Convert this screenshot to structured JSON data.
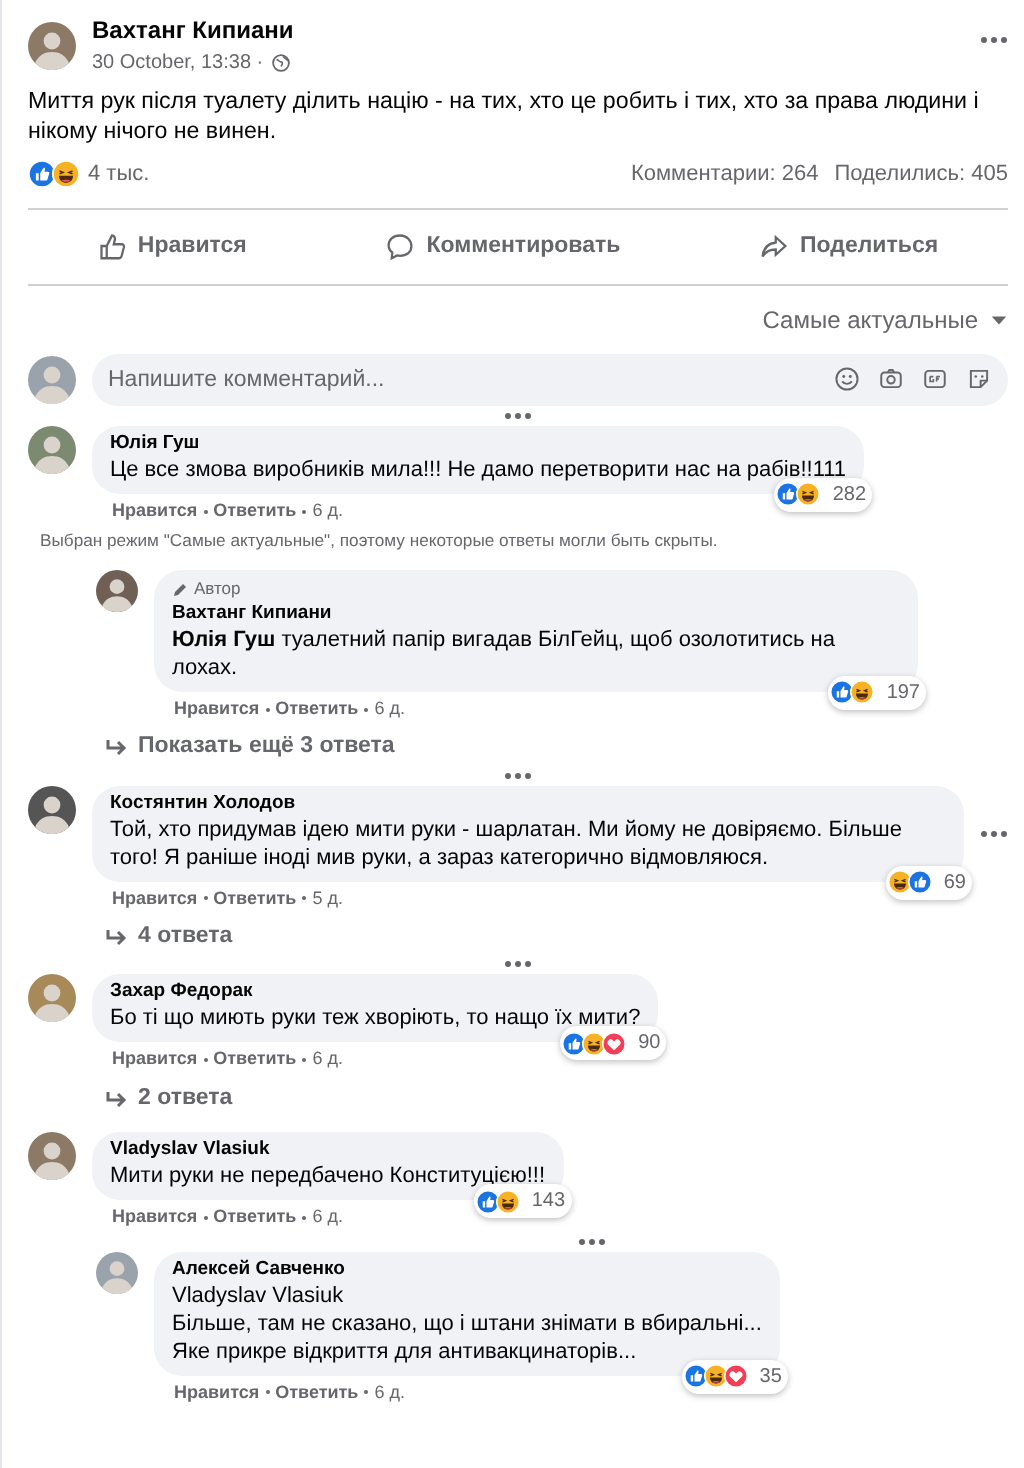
{
  "post": {
    "author": "Вахтанг Кипиани",
    "time": "30 October, 13:38 ·",
    "text": "Миття рук після туалету ділить націю - на тих, хто це робить і тих, хто за права людини і нікому нічого не винен.",
    "reactions": [
      {
        "kind": "like"
      },
      {
        "kind": "haha"
      }
    ],
    "reaction_count": "4 тыс.",
    "comments_count": "Комментарии: 264",
    "shares_count": "Поделились: 405"
  },
  "actions": [
    {
      "kind": "like",
      "label": "Нравится"
    },
    {
      "kind": "comment",
      "label": "Комментировать"
    },
    {
      "kind": "share",
      "label": "Поделиться"
    }
  ],
  "sort": "Самые актуальные",
  "comment_box": {
    "placeholder": "Напишите комментарий..."
  },
  "comments": [
    {
      "menu_above": true,
      "author": "Юлія Гуш",
      "text": "Це все змова виробників мила!!! Не дамо перетворити нас на рабів!!111",
      "reactions": [
        {
          "kind": "like"
        },
        {
          "kind": "haha"
        }
      ],
      "reaction_count": "282",
      "actions": [
        "Нравится",
        "Ответить"
      ],
      "time": "6 д.",
      "note": "Выбран режим \"Самые актуальные\", поэтому некоторые ответы могли быть скрыты.",
      "replies": [
        {
          "badge": "Автор",
          "author": "Вахтанг Кипиани",
          "text": "**Юлія Гуш** туалетний папір вигадав БілГейц, щоб озолотитись на лохах.",
          "reactions": [
            {
              "kind": "like"
            },
            {
              "kind": "haha"
            }
          ],
          "reaction_count": "197",
          "actions": [
            "Нравится",
            "Ответить"
          ],
          "time": "6 д."
        }
      ],
      "more_replies": "Показать ещё 3 ответа"
    },
    {
      "menu_above": true,
      "side_menu": true,
      "author": "Костянтин Холодов",
      "text": "Той, хто придумав ідею мити руки - шарлатан. Ми йому не довіряємо. Більше того! Я раніше іноді мив руки, а зараз категорично відмовляюся.",
      "reactions": [
        {
          "kind": "haha"
        },
        {
          "kind": "like"
        }
      ],
      "reaction_count": "69",
      "actions": [
        "Нравится",
        "Ответить"
      ],
      "time": "5 д.",
      "more_replies": "4 ответа"
    },
    {
      "menu_above": true,
      "author": "Захар Федорак",
      "text": "Бо ті що миють руки теж хворіють, то нащо їх мити?",
      "reactions": [
        {
          "kind": "like"
        },
        {
          "kind": "haha"
        },
        {
          "kind": "love"
        }
      ],
      "reaction_count": "90",
      "actions": [
        "Нравится",
        "Ответить"
      ],
      "time": "6 д.",
      "more_replies": "2 ответа"
    },
    {
      "author": "Vladyslav Vlasiuk",
      "text": "Мити руки не передбачено Конституцією!!!",
      "reactions": [
        {
          "kind": "like"
        },
        {
          "kind": "haha"
        }
      ],
      "reaction_count": "143",
      "actions": [
        "Нравится",
        "Ответить"
      ],
      "time": "6 д.",
      "replies": [
        {
          "menu_above": true,
          "author": "Алексей Савченко",
          "text": "Vladyslav Vlasiuk\nБільше, там не сказано, що і штани знімати в вбиральні...\nЯке прикре відкриття для антивакцинаторів...",
          "reactions": [
            {
              "kind": "like"
            },
            {
              "kind": "haha"
            },
            {
              "kind": "love"
            }
          ],
          "reaction_count": "35",
          "actions": [
            "Нравится",
            "Ответить"
          ],
          "time": "6 д."
        }
      ]
    }
  ]
}
